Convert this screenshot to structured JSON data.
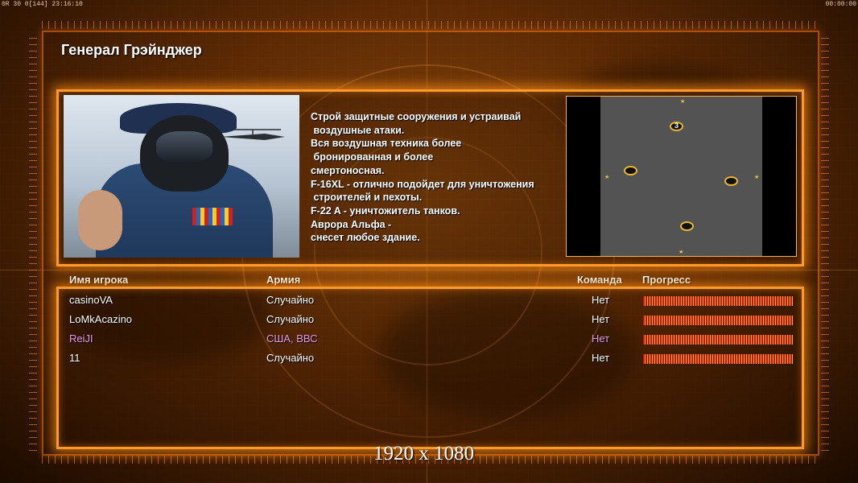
{
  "topbar": {
    "left": "0R 30 0[144] 23:16:10",
    "right": "00:00:00"
  },
  "general": {
    "title": "Генерал Грэйнджер",
    "description": "Строй защитные сооружения и устраивай\n воздушные атаки.\nВся воздушная техника более\n бронированная и более\nсмертоносная.\nF-16XL - отлично подойдет для уничтожения\n строителей и пехоты.\nF-22 A - уничтожитель танков.\nАврора Альфа -\nснесет любое здание."
  },
  "minimap": {
    "player_marker_number": "3"
  },
  "table": {
    "headers": {
      "name": "Имя игрока",
      "army": "Армия",
      "team": "Команда",
      "progress": "Прогресс"
    },
    "rows": [
      {
        "name": "casinoVA",
        "army": "Случайно",
        "team": "Нет",
        "highlight": false
      },
      {
        "name": "LoMkAcazino",
        "army": "Случайно",
        "team": "Нет",
        "highlight": false
      },
      {
        "name": "ReiJI",
        "army": "США, ВВС",
        "team": "Нет",
        "highlight": true
      },
      {
        "name": "11",
        "army": "Случайно",
        "team": "Нет",
        "highlight": false
      }
    ]
  },
  "resolution_label": "1920 x 1080",
  "colors": {
    "accent": "#ff9a2a",
    "highlight_player": "#e89ae8",
    "progress_red": "#c51414",
    "progress_gold": "#f6b821"
  }
}
